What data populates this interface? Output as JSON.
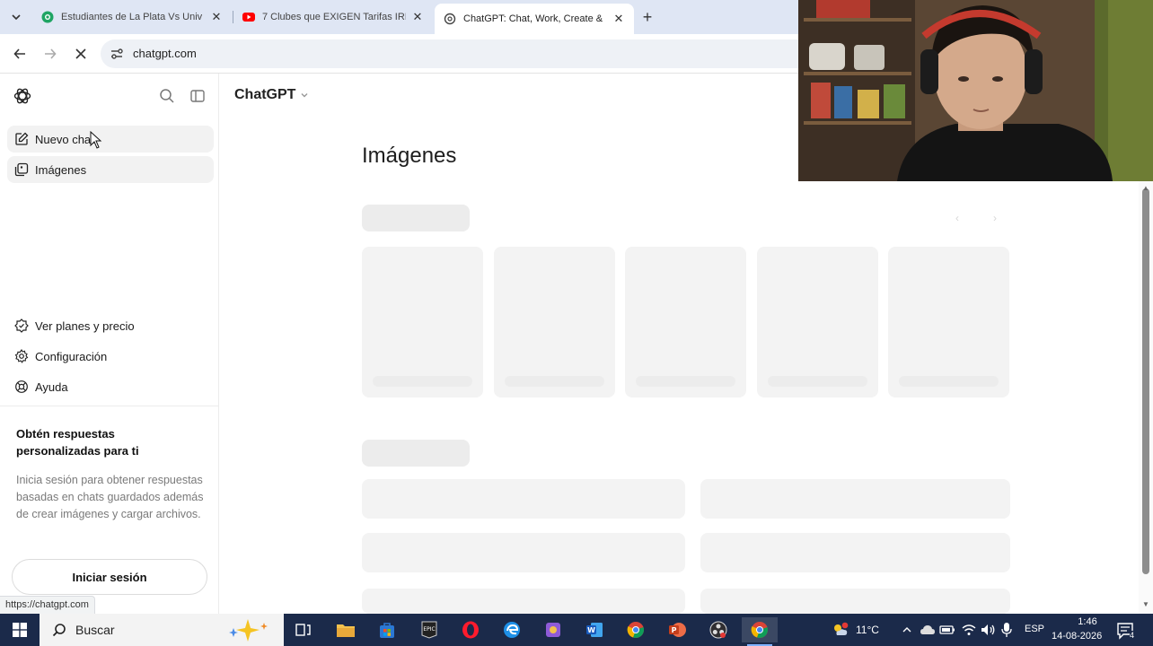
{
  "browser": {
    "tabs": [
      {
        "title": "Estudiantes de La Plata Vs Univ",
        "favicon": "green-globe-icon"
      },
      {
        "title": "7 Clubes que EXIGEN Tarifas IRI",
        "favicon": "youtube-icon"
      },
      {
        "title": "ChatGPT: Chat, Work, Create &",
        "favicon": "chatgpt-icon",
        "active": true
      }
    ],
    "url": "chatgpt.com",
    "status_url": "https://chatgpt.com"
  },
  "sidebar": {
    "items": [
      {
        "label": "Nuevo chat",
        "icon": "edit-icon"
      },
      {
        "label": "Imágenes",
        "icon": "images-icon"
      }
    ],
    "footer_items": [
      {
        "label": "Ver planes y precio",
        "icon": "plan-icon"
      },
      {
        "label": "Configuración",
        "icon": "gear-icon"
      },
      {
        "label": "Ayuda",
        "icon": "help-icon"
      }
    ],
    "promo": {
      "title": "Obtén respuestas personalizadas para ti",
      "text": "Inicia sesión para obtener respuestas basadas en chats guardados además de crear imágenes y cargar archivos.",
      "button": "Iniciar sesión"
    }
  },
  "main": {
    "model": "ChatGPT",
    "title": "Imágenes"
  },
  "taskbar": {
    "search_placeholder": "Buscar",
    "temperature": "11°C",
    "language": "ESP",
    "time": "1:46",
    "date": "14-08-2026",
    "notifications": "4"
  },
  "colors": {
    "accent_youtube": "#ff0000",
    "accent_green": "#1fa463",
    "taskbar": "#1b2a4a"
  }
}
